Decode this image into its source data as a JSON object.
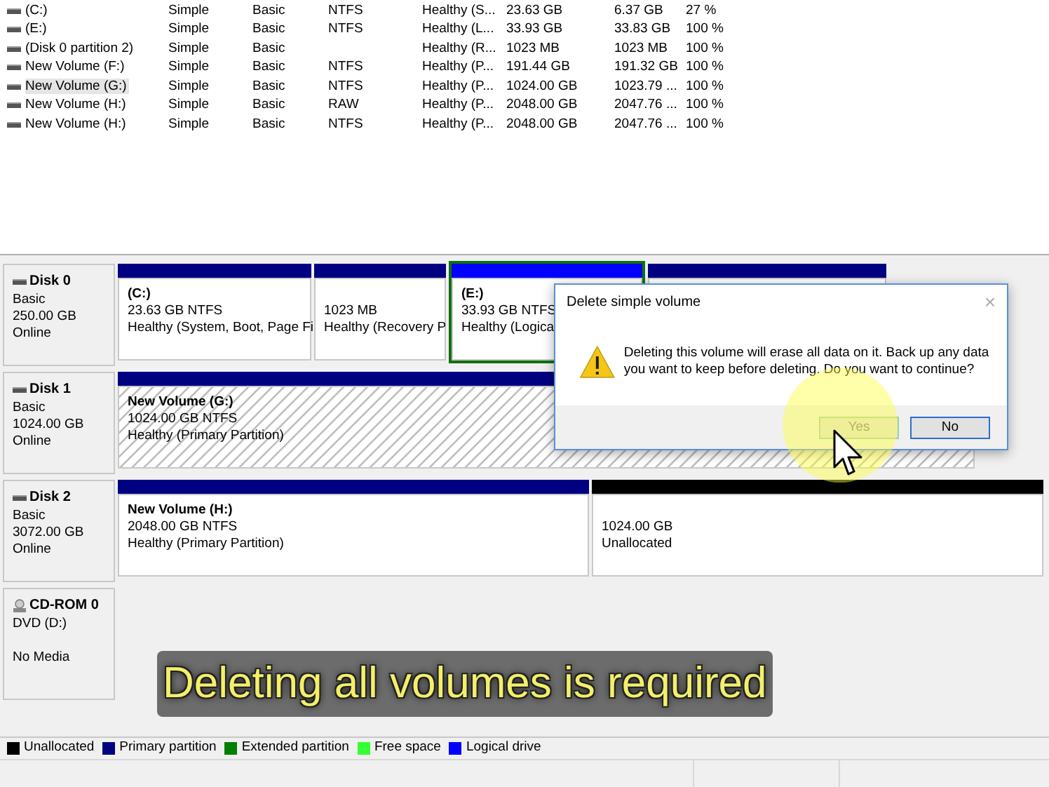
{
  "volumes": [
    {
      "name": "(C:)",
      "layout": "Simple",
      "type": "Basic",
      "file_system": "NTFS",
      "status": "Healthy (S...",
      "capacity": "23.63 GB",
      "free_space": "6.37 GB",
      "percent_free": "27 %",
      "selected": false
    },
    {
      "name": "(E:)",
      "layout": "Simple",
      "type": "Basic",
      "file_system": "NTFS",
      "status": "Healthy (L...",
      "capacity": "33.93 GB",
      "free_space": "33.83 GB",
      "percent_free": "100 %",
      "selected": false
    },
    {
      "name": "(Disk 0 partition 2)",
      "layout": "Simple",
      "type": "Basic",
      "status": "Healthy (R...",
      "capacity": "1023 MB",
      "free_space": "1023 MB",
      "percent_free": "100 %",
      "selected": false
    },
    {
      "name": "New Volume (F:)",
      "layout": "Simple",
      "type": "Basic",
      "file_system": "NTFS",
      "status": "Healthy (P...",
      "capacity": "191.44 GB",
      "free_space": "191.32 GB",
      "percent_free": "100 %",
      "selected": false
    },
    {
      "name": "New Volume (G:)",
      "layout": "Simple",
      "type": "Basic",
      "file_system": "NTFS",
      "status": "Healthy (P...",
      "capacity": "1024.00 GB",
      "free_space": "1023.79 ...",
      "percent_free": "100 %",
      "selected": true
    },
    {
      "name": "New Volume (H:)",
      "layout": "Simple",
      "type": "Basic",
      "file_system": "RAW",
      "status": "Healthy (P...",
      "capacity": "2048.00 GB",
      "free_space": "2047.76 ...",
      "percent_free": "100 %",
      "selected": false
    },
    {
      "name": "New Volume (H:)",
      "layout": "Simple",
      "type": "Basic",
      "file_system": "NTFS",
      "status": "Healthy (P...",
      "capacity": "2048.00 GB",
      "free_space": "2047.76 ...",
      "percent_free": "100 %",
      "selected": false
    }
  ],
  "disks": [
    {
      "kind": "disk",
      "name": "Disk 0",
      "lines": [
        "Basic",
        "250.00 GB",
        "Online"
      ],
      "partitions": [
        {
          "kind": "primary",
          "title": "(C:)",
          "size": "23.63 GB NTFS",
          "status": "Healthy (System, Boot, Page Fi",
          "selected": false,
          "hatched": false
        },
        {
          "kind": "primary",
          "size": "1023 MB",
          "status": "Healthy (Recovery P",
          "selected": false,
          "hatched": false
        },
        {
          "kind": "logical",
          "title": "(E:)",
          "size": "33.93 GB NTFS",
          "status": "Healthy (Logica",
          "selected": true,
          "hatched": false
        },
        {
          "kind": "primary",
          "selected": false,
          "hatched": false
        }
      ]
    },
    {
      "kind": "disk",
      "name": "Disk 1",
      "lines": [
        "Basic",
        "1024.00 GB",
        "Online"
      ],
      "partitions": [
        {
          "kind": "primary",
          "title": "New Volume  (G:)",
          "size": "1024.00 GB NTFS",
          "status": "Healthy (Primary Partition)",
          "selected": false,
          "hatched": true
        }
      ]
    },
    {
      "kind": "disk",
      "name": "Disk 2",
      "lines": [
        "Basic",
        "3072.00 GB",
        "Online"
      ],
      "partitions": [
        {
          "kind": "primary",
          "title": "New Volume  (H:)",
          "size": "2048.00 GB NTFS",
          "status": "Healthy (Primary Partition)",
          "selected": false,
          "hatched": false
        },
        {
          "kind": "unallocated",
          "size": "1024.00 GB",
          "status": "Unallocated",
          "selected": false,
          "hatched": false
        }
      ]
    },
    {
      "kind": "cdrom",
      "name": "CD-ROM 0",
      "lines": [
        "DVD (D:)",
        "No Media"
      ]
    }
  ],
  "legend": [
    {
      "label": "Unallocated",
      "color": "#000000"
    },
    {
      "label": "Primary partition",
      "color": "#000080"
    },
    {
      "label": "Extended partition",
      "color": "#008000"
    },
    {
      "label": "Free space",
      "color": "#33ff33"
    },
    {
      "label": "Logical drive",
      "color": "#0000ff"
    }
  ],
  "dialog": {
    "title": "Delete simple volume",
    "close": "×",
    "message": "Deleting this volume will erase all data on it. Back up any data you want to keep before deleting. Do you want to continue?",
    "buttons": [
      {
        "label": "Yes",
        "selected": true
      },
      {
        "label": "No",
        "selected": false
      }
    ]
  },
  "caption": "Deleting all volumes is required"
}
